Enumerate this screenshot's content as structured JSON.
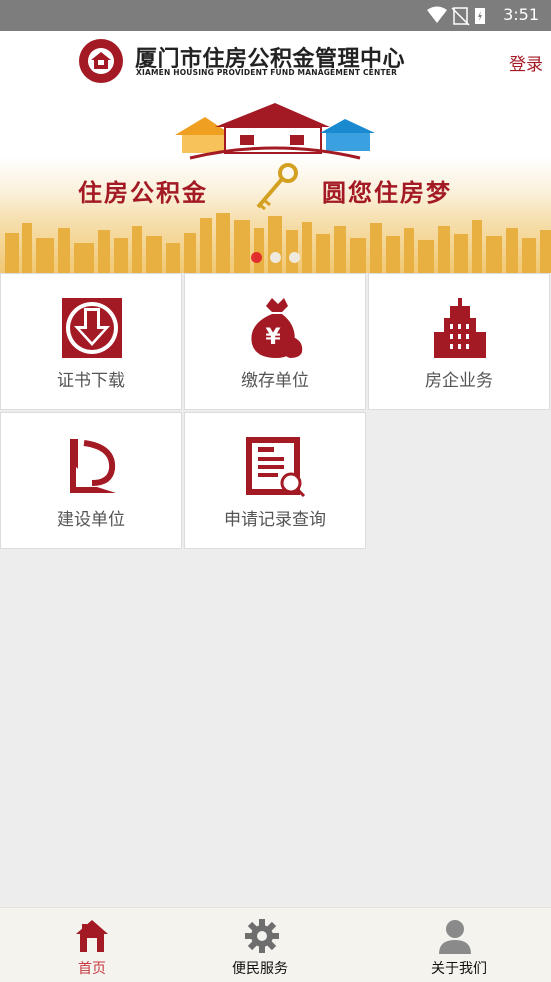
{
  "status_bar": {
    "time": "3:51"
  },
  "header": {
    "title_cn": "厦门市住房公积金管理中心",
    "title_en": "XIAMEN HOUSING PROVIDENT FUND MANAGEMENT CENTER",
    "login_label": "登录"
  },
  "banner": {
    "slogan_left": "住房公积金",
    "slogan_right": "圆您住房梦",
    "active_slide": 1,
    "slide_count": 3
  },
  "grid": {
    "items": [
      {
        "label": "证书下载",
        "icon": "download-certificate-icon"
      },
      {
        "label": "缴存单位",
        "icon": "money-bag-icon"
      },
      {
        "label": "房企业务",
        "icon": "building-icon"
      },
      {
        "label": "建设单位",
        "icon": "construction-ruler-icon"
      },
      {
        "label": "申请记录查询",
        "icon": "record-search-icon"
      }
    ]
  },
  "bottom_nav": {
    "items": [
      {
        "label": "首页",
        "icon": "home-icon",
        "active": true
      },
      {
        "label": "便民服务",
        "icon": "gear-icon",
        "active": false
      },
      {
        "label": "关于我们",
        "icon": "person-icon",
        "active": false
      }
    ]
  },
  "colors": {
    "brand": "#a31a24",
    "status_bar": "#7d7d7d",
    "background": "#ededed"
  }
}
